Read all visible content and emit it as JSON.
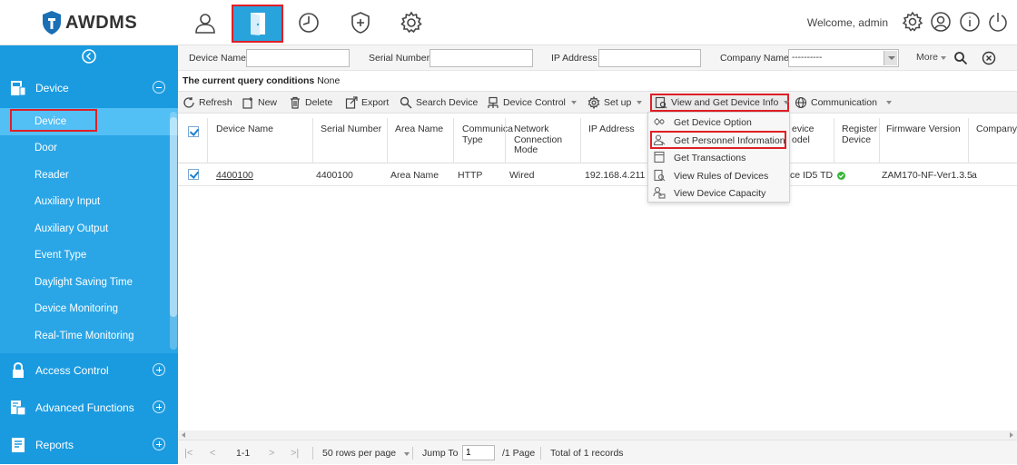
{
  "app": {
    "logo_text": "AWDMS"
  },
  "header": {
    "welcome": "Welcome, admin",
    "nav_icons": [
      "person-icon",
      "door-icon",
      "clock-icon",
      "shield-plus-icon",
      "gear-icon"
    ],
    "right_icons": [
      "settings-icon",
      "user-circle-icon",
      "info-icon",
      "power-icon"
    ]
  },
  "sidebar": {
    "groups": [
      {
        "label": "Device",
        "icon": "device-icon",
        "expanded": true
      },
      {
        "label": "Access Control",
        "icon": "lock-icon",
        "expanded": false
      },
      {
        "label": "Advanced Functions",
        "icon": "advanced-icon",
        "expanded": false
      },
      {
        "label": "Reports",
        "icon": "reports-icon",
        "expanded": false
      }
    ],
    "items": [
      "Device",
      "Door",
      "Reader",
      "Auxiliary Input",
      "Auxiliary Output",
      "Event Type",
      "Daylight Saving Time",
      "Device Monitoring",
      "Real-Time Monitoring"
    ],
    "active_item": "Device"
  },
  "query": {
    "device_name_label": "Device Name",
    "device_name_value": "",
    "serial_number_label": "Serial Number",
    "serial_number_value": "",
    "ip_address_label": "IP Address",
    "ip_address_value": "",
    "company_name_label": "Company Name",
    "company_name_value": "----------",
    "more_label": "More",
    "conditions_label": "The current query conditions",
    "conditions_value": "None"
  },
  "toolbar": {
    "refresh": "Refresh",
    "new": "New",
    "delete": "Delete",
    "export": "Export",
    "search_device": "Search Device",
    "device_control": "Device Control",
    "setup": "Set up",
    "view_get_info": "View and Get Device Info",
    "communication": "Communication"
  },
  "dropdown": {
    "items": [
      {
        "label": "Get Device Option",
        "icon": "device-option-icon"
      },
      {
        "label": "Get Personnel Information",
        "icon": "personnel-icon"
      },
      {
        "label": "Get Transactions",
        "icon": "transactions-icon"
      },
      {
        "label": "View Rules of Devices",
        "icon": "rules-icon"
      },
      {
        "label": "View Device Capacity",
        "icon": "capacity-icon"
      }
    ]
  },
  "table": {
    "headers": {
      "device_name": "Device Name",
      "serial_number": "Serial Number",
      "area_name": "Area Name",
      "comm_type_1": "Communica",
      "comm_type_2": "Type",
      "net_1": "Network",
      "net_2": "Connection",
      "net_3": "Mode",
      "ip_address": "IP Address",
      "model_1": "evice",
      "model_2": "odel",
      "register_1": "Register",
      "register_2": "Device",
      "firmware": "Firmware Version",
      "company": "Company"
    },
    "rows": [
      {
        "device_name": "4400100",
        "serial_number": "4400100",
        "area_name": "Area Name",
        "comm_type": "HTTP",
        "network_mode": "Wired",
        "ip_address": "192.168.4.211",
        "model": "ce ID5 TD",
        "register_device": true,
        "firmware": "ZAM170-NF-Ver1.3.5",
        "company": "a",
        "selected": true
      }
    ]
  },
  "pager": {
    "range": "1-1",
    "rows_per_page": "50 rows per page",
    "jump_to_label": "Jump To",
    "jump_to_value": "1",
    "page_count": "/1 Page",
    "total": "Total of 1 records"
  },
  "colors": {
    "sidebar": "#1a9be0",
    "sidebar_sub": "#2aa6e7",
    "active_item": "#52bff5",
    "highlight_outline": "#e01f26"
  }
}
